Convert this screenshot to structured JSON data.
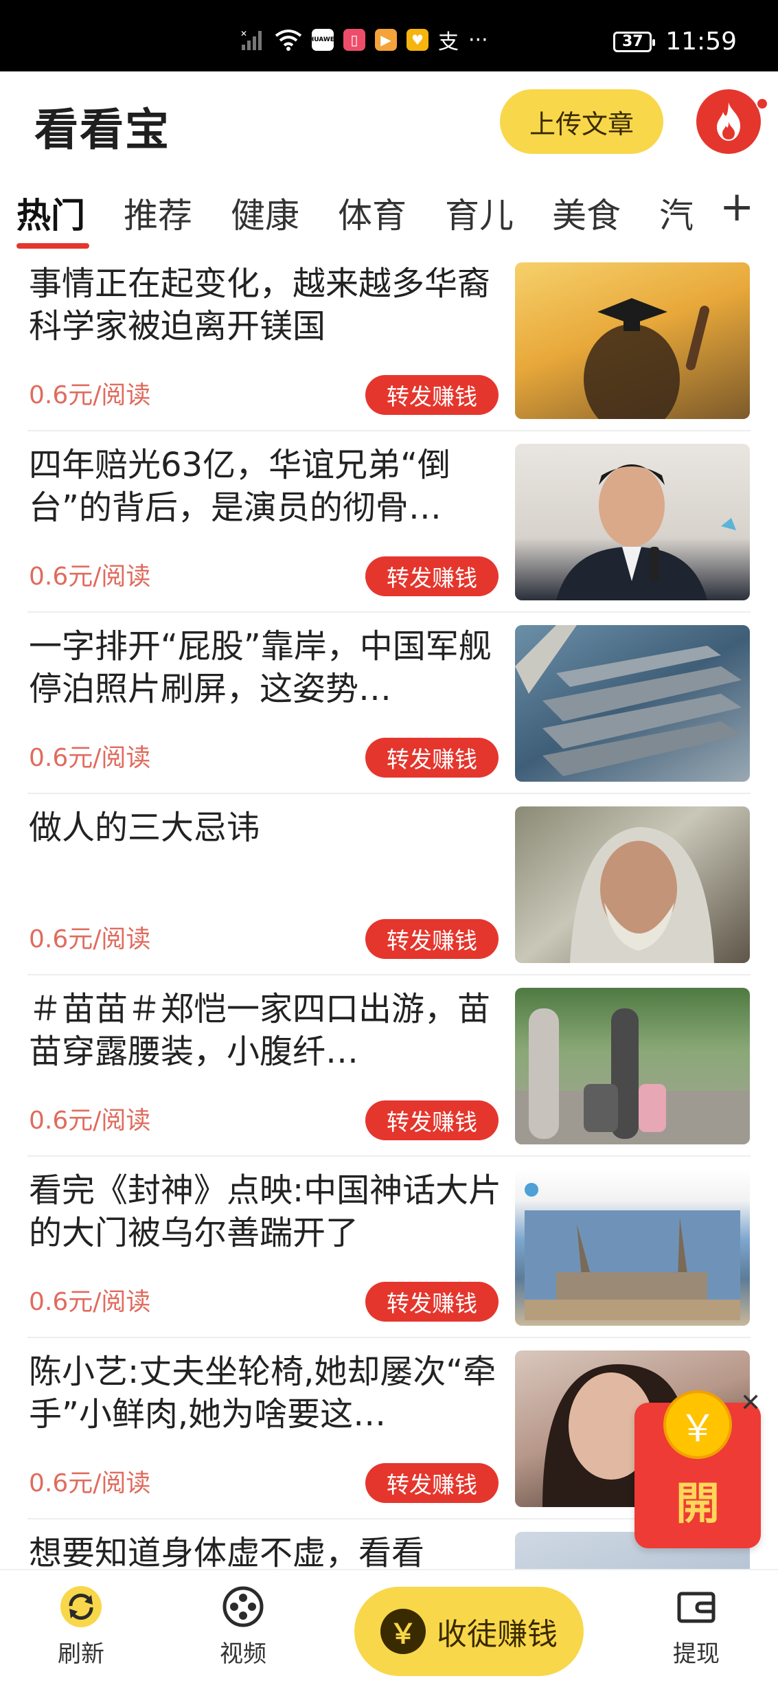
{
  "status_bar": {
    "time": "11:59",
    "battery": "37",
    "carrier_label": "HUAWEI",
    "more": "···",
    "alipay_glyph": "支",
    "icons": [
      "signal-off-icon",
      "wifi-icon",
      "huawei-icon",
      "book-app-icon",
      "video-app-icon",
      "heart-app-icon",
      "alipay-icon"
    ]
  },
  "header": {
    "title": "看看宝",
    "upload_label": "上传文章"
  },
  "tabs": {
    "items": [
      "热门",
      "推荐",
      "健康",
      "体育",
      "育儿",
      "美食",
      "汽"
    ],
    "active_index": 0,
    "more_label": "+"
  },
  "feed": {
    "items": [
      {
        "title": "事情正在起变化，越来越多华裔科学家被迫离开镁国",
        "price": "0.6元/阅读",
        "action": "转发赚钱"
      },
      {
        "title": "四年赔光63亿，华谊兄弟“倒台”的背后，是演员的彻骨…",
        "price": "0.6元/阅读",
        "action": "转发赚钱"
      },
      {
        "title": "一字排开“屁股”靠岸，中国军舰停泊照片刷屏，这姿势…",
        "price": "0.6元/阅读",
        "action": "转发赚钱"
      },
      {
        "title": "做人的三大忌讳",
        "price": "0.6元/阅读",
        "action": "转发赚钱"
      },
      {
        "title": "＃苗苗＃郑恺一家四口出游，苗苗穿露腰装，小腹纤…",
        "price": "0.6元/阅读",
        "action": "转发赚钱"
      },
      {
        "title": "看完《封神》点映:中国神话大片的大门被乌尔善踹开了",
        "price": "0.6元/阅读",
        "action": "转发赚钱"
      },
      {
        "title": "陈小艺:丈夫坐轮椅,她却屡次“牵手”小鲜肉,她为啥要这…",
        "price": "0.6元/阅读",
        "action": "转发赚钱"
      },
      {
        "title": "想要知道身体虚不虚，看看",
        "price": "",
        "action": ""
      }
    ]
  },
  "red_packet": {
    "coin_symbol": "￥",
    "label": "開",
    "close_label": "✕"
  },
  "bottom_nav": {
    "refresh_label": "刷新",
    "video_label": "视频",
    "recruit_label": "收徒赚钱",
    "recruit_symbol": "￥",
    "withdraw_label": "提现"
  },
  "colors": {
    "accent_yellow": "#f8d74a",
    "accent_red": "#e5362d",
    "price_text": "#e06b5d"
  }
}
